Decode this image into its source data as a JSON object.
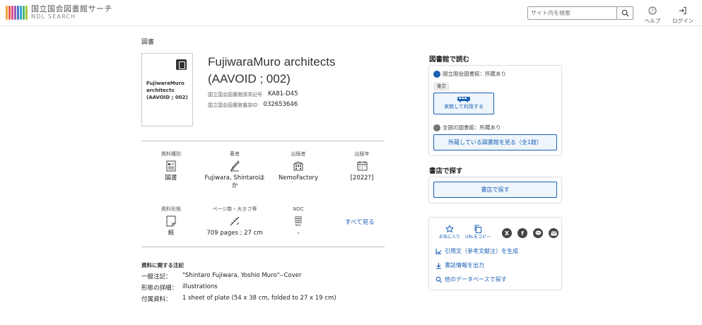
{
  "header": {
    "logo_title": "国立国会図書館サーチ",
    "logo_sub": "NDL SEARCH",
    "logo_colors": [
      "#f2a33a",
      "#e85d4a",
      "#d94f8c",
      "#9b59b6",
      "#4a78c7",
      "#3aa3d9",
      "#4cb86b",
      "#a5c83f"
    ],
    "search_placeholder": "サイト内を検索",
    "help_label": "ヘルプ",
    "login_label": "ログイン"
  },
  "breadcrumb": "図書",
  "item": {
    "thumb_title": "FujiwaraMuro architects (AAVOID ; 002)",
    "title_line1": "FujiwaraMuro architects",
    "title_line2": "(AAVOID ; 002)",
    "call_number_label": "国立国会図書館請求記号",
    "call_number": "KA81-D45",
    "biblio_id_label": "国立国会図書館書誌ID",
    "biblio_id": "032653646"
  },
  "facets": {
    "type_label": "資料種別",
    "type_value": "図書",
    "author_label": "著者",
    "author_value_line1": "Fujiwara, Shintaroほ",
    "author_value_line2": "か",
    "publisher_label": "出版者",
    "publisher_value": "NemoFactory",
    "year_label": "出版年",
    "year_value": "[2022?]",
    "form_label": "資料形態",
    "form_value": "紙",
    "pages_label": "ページ数・大きさ等",
    "pages_value": "709 pages ; 27 cm",
    "ndc_label": "NDC",
    "ndc_value": "-",
    "see_all": "すべて見る"
  },
  "notes": {
    "heading": "資料に関する注記",
    "rows": [
      {
        "key": "一般注記：",
        "value": "\"Shintaro Fujiwara, Yoshio Muro\"--Cover"
      },
      {
        "key": "形態の詳細：",
        "value": "illustrations"
      },
      {
        "key": "付属資料：",
        "value": "1 sheet of plate (54 x 38 cm, folded to 27 x 19 cm)"
      }
    ]
  },
  "read": {
    "heading": "図書館で読む",
    "ndl_status": "国立国会図書館：所蔵あり",
    "tag_tokyo": "東京",
    "visit_button": "来館して利用する",
    "national_status": "全国の図書館：所蔵あり",
    "libraries_button": "所蔵している図書館を見る（全1館）"
  },
  "shop": {
    "heading": "書店で探す",
    "button": "書店で探す"
  },
  "share": {
    "favorite_label": "お気に入り",
    "copy_url_label": "URLをコピー",
    "x_glyph": "X",
    "facebook_glyph": "f",
    "cite_link": "引用文（参考文献注）を生成",
    "export_link": "書誌情報を出力",
    "other_db_link": "他のデータベースで探す"
  },
  "colors": {
    "accent": "#1a5fb4",
    "panel_border": "#dddddd"
  }
}
